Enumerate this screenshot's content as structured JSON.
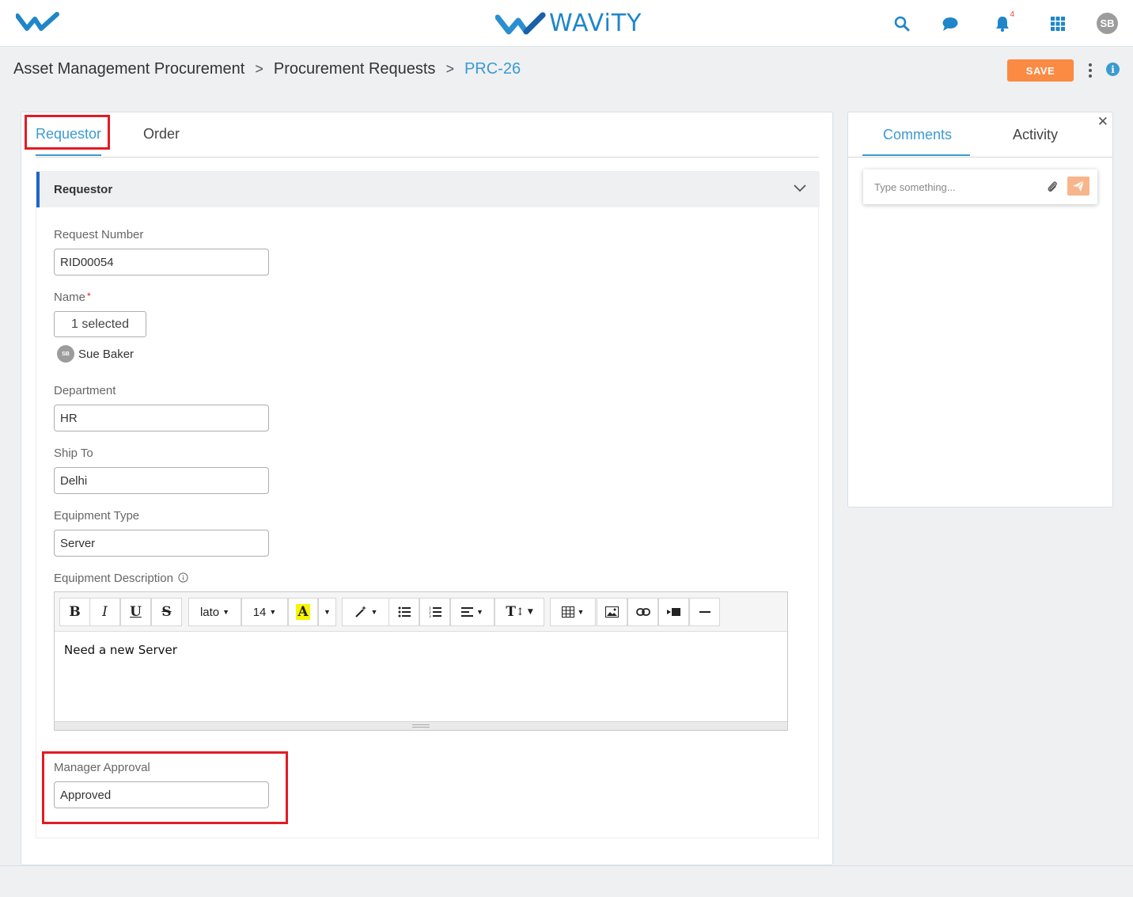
{
  "app": {
    "brand_name": "WAViTY",
    "brand_color": "#1f86c9",
    "notification_count": "4",
    "user_initials": "SB",
    "icons": [
      "search-icon",
      "chat-icon",
      "bell-icon",
      "apps-grid-icon"
    ]
  },
  "breadcrumb": {
    "items": [
      "Asset Management Procurement",
      "Procurement Requests"
    ],
    "separator": ">",
    "current": "PRC-26"
  },
  "actions": {
    "save_label": "SAVE",
    "save_color": "#fb8a43"
  },
  "tabs": [
    {
      "label": "Requestor",
      "active": true
    },
    {
      "label": "Order",
      "active": false
    }
  ],
  "section": {
    "title": "Requestor",
    "fields": {
      "request_number": {
        "label": "Request Number",
        "value": "RID00054"
      },
      "name": {
        "label": "Name",
        "required_mark": "*",
        "selected_label": "1 selected",
        "person_initials": "SB",
        "person_name": "Sue Baker"
      },
      "department": {
        "label": "Department",
        "value": "HR"
      },
      "ship_to": {
        "label": "Ship To",
        "value": "Delhi"
      },
      "equipment_type": {
        "label": "Equipment Type",
        "value": "Server"
      },
      "equipment_description": {
        "label": "Equipment Description",
        "font_name": "lato",
        "font_size": "14",
        "content": "Need a new Server"
      },
      "manager_approval": {
        "label": "Manager Approval",
        "value": "Approved"
      }
    }
  },
  "side_panel": {
    "tabs": [
      {
        "label": "Comments",
        "active": true
      },
      {
        "label": "Activity",
        "active": false
      }
    ],
    "comment_placeholder": "Type something..."
  },
  "highlight_color": "#e21b23"
}
